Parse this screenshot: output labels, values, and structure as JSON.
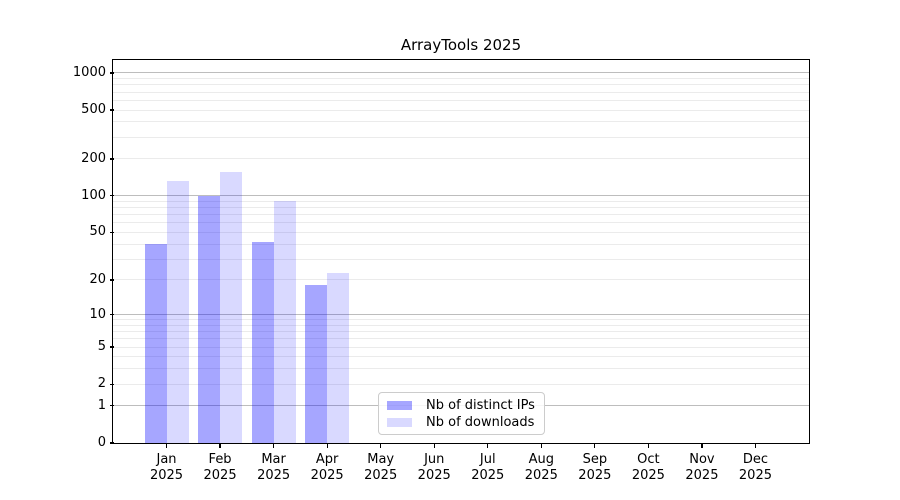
{
  "chart_data": {
    "type": "bar",
    "title": "ArrayTools 2025",
    "categories": [
      "Jan",
      "Feb",
      "Mar",
      "Apr",
      "May",
      "Jun",
      "Jul",
      "Aug",
      "Sep",
      "Oct",
      "Nov",
      "Dec"
    ],
    "category_year": "2025",
    "series": [
      {
        "name": "Nb of distinct IPs",
        "color": "rgba(0,0,255,0.35)",
        "color_on_white": "#a6a6ff",
        "values": [
          40,
          100,
          42,
          18,
          0,
          0,
          0,
          0,
          0,
          0,
          0,
          0
        ]
      },
      {
        "name": "Nb of downloads",
        "color": "rgba(0,0,255,0.15)",
        "color_on_white": "#d9d9ff",
        "values": [
          131,
          157,
          90,
          23,
          0,
          0,
          0,
          0,
          0,
          0,
          0,
          0
        ]
      }
    ],
    "xlabel": "",
    "ylabel": "",
    "y_axis": {
      "scale": "log1p",
      "tick_values": [
        0,
        1,
        2,
        5,
        10,
        20,
        50,
        100,
        200,
        500,
        1000
      ],
      "tick_labels": [
        "0",
        "1",
        "2",
        "5",
        "10",
        "20",
        "50",
        "100",
        "200",
        "500",
        "1000"
      ],
      "ylim": [
        0,
        1270
      ],
      "grid": "on",
      "major_grid_color": "#bdbdbd",
      "minor_grid_color": "#ebebeb"
    },
    "legend": {
      "position": "inside bottom-center",
      "entries": [
        "Nb of distinct IPs",
        "Nb of downloads"
      ]
    }
  }
}
